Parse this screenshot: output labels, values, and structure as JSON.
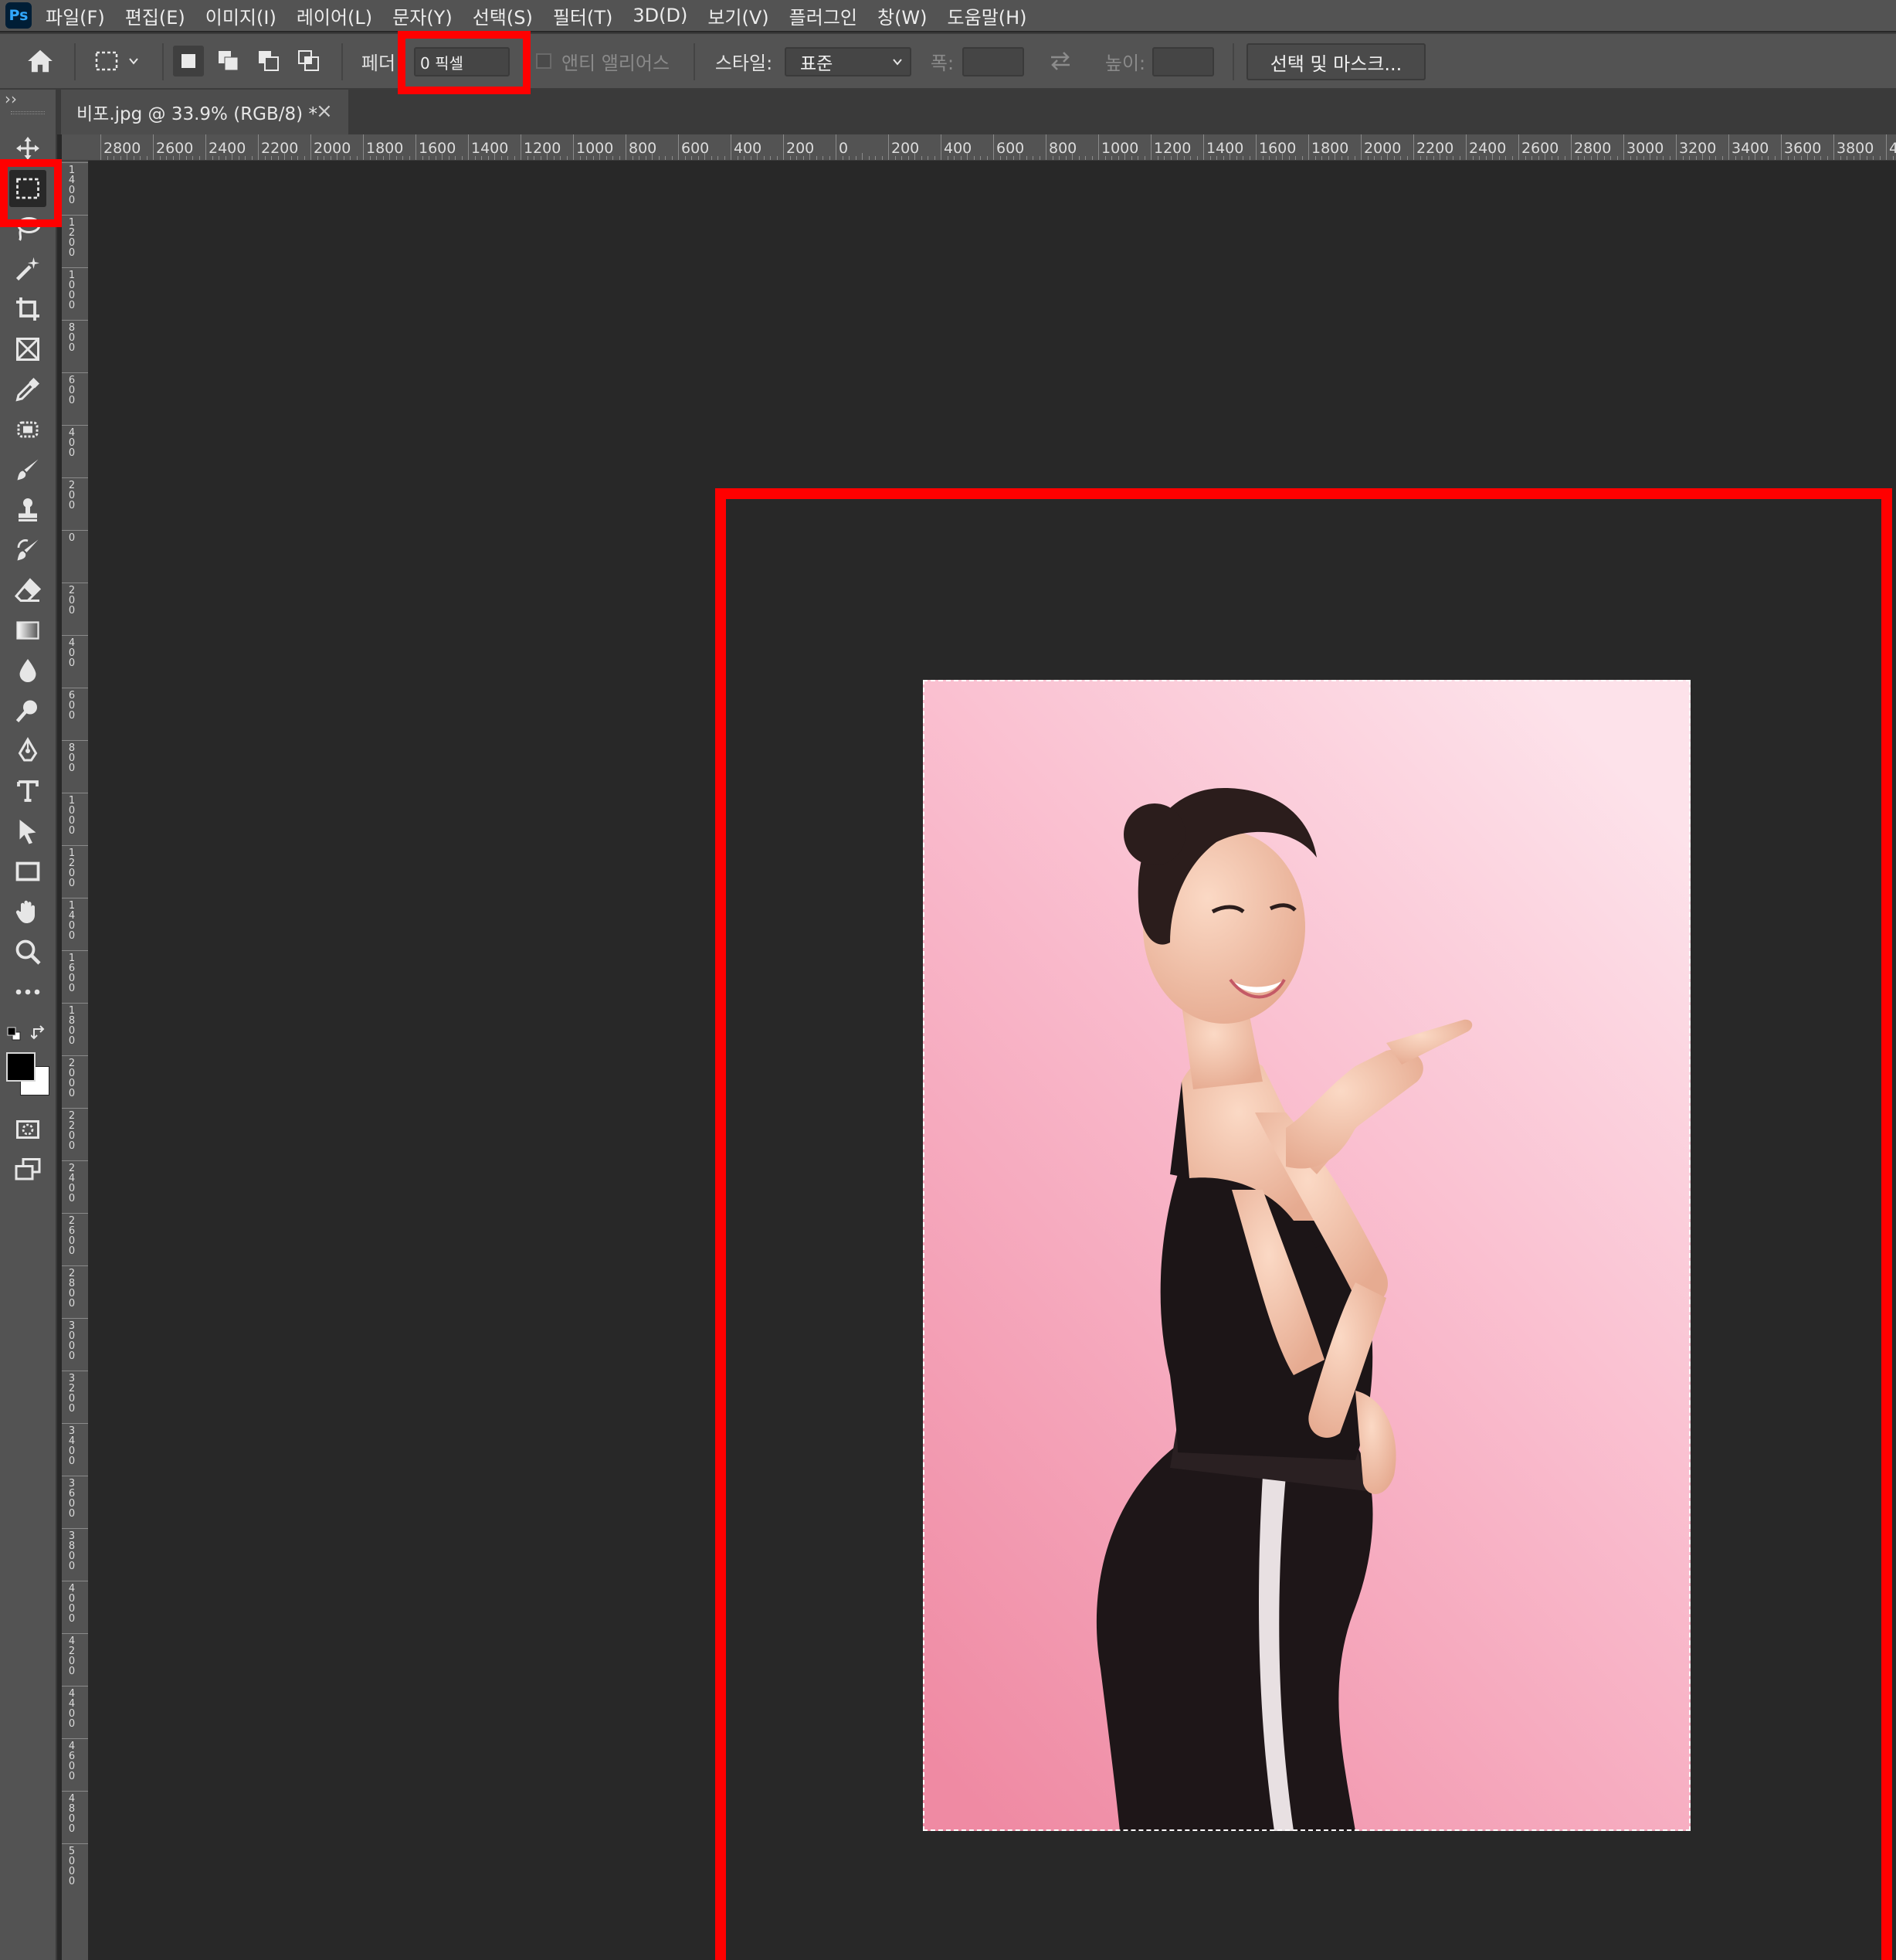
{
  "app": {
    "logo": "Ps"
  },
  "menu": {
    "items": [
      "파일(F)",
      "편집(E)",
      "이미지(I)",
      "레이어(L)",
      "문자(Y)",
      "선택(S)",
      "필터(T)",
      "3D(D)",
      "보기(V)",
      "플러그인",
      "창(W)",
      "도움말(H)"
    ]
  },
  "options": {
    "feather_label": "페더",
    "feather_value": "0 픽셀",
    "antialias_label": "앤티 앨리어스",
    "style_label": "스타일:",
    "style_value": "표준",
    "width_label": "폭:",
    "height_label": "높이:",
    "select_mask_button": "선택 및 마스크..."
  },
  "document": {
    "tab_title": "비포.jpg @ 33.9% (RGB/8) *",
    "close_glyph": "×"
  },
  "rulers": {
    "top_labels": [
      "2800",
      "2600",
      "2400",
      "2200",
      "2000",
      "1800",
      "1600",
      "1400",
      "1200",
      "1000",
      "800",
      "600",
      "400",
      "200",
      "0",
      "200",
      "400",
      "600",
      "800",
      "1000",
      "1200",
      "1400",
      "1600",
      "1800",
      "2000",
      "2200",
      "2400",
      "2600",
      "2800",
      "3000",
      "3200",
      "3400",
      "3600",
      "3800",
      "4"
    ],
    "left_labels": [
      "1400",
      "1200",
      "1000",
      "800",
      "600",
      "400",
      "200",
      "0",
      "200",
      "400",
      "600",
      "800",
      "1000",
      "1200",
      "1400",
      "1600",
      "1800",
      "2000",
      "2200",
      "2400",
      "2600",
      "2800",
      "3000",
      "3200",
      "3400",
      "3600",
      "3800",
      "4000",
      "4200",
      "4400",
      "4600",
      "4800",
      "5000"
    ]
  },
  "tools": [
    {
      "icon": "move-icon"
    },
    {
      "icon": "rectangular-marquee-icon",
      "active": true
    },
    {
      "icon": "lasso-icon"
    },
    {
      "icon": "magic-wand-icon"
    },
    {
      "icon": "crop-icon"
    },
    {
      "icon": "frame-icon"
    },
    {
      "icon": "eyedropper-icon"
    },
    {
      "icon": "spot-healing-icon"
    },
    {
      "icon": "brush-icon"
    },
    {
      "icon": "clone-stamp-icon"
    },
    {
      "icon": "history-brush-icon"
    },
    {
      "icon": "eraser-icon"
    },
    {
      "icon": "gradient-icon"
    },
    {
      "icon": "blur-icon"
    },
    {
      "icon": "dodge-icon"
    },
    {
      "icon": "pen-icon"
    },
    {
      "icon": "type-icon"
    },
    {
      "icon": "path-selection-icon"
    },
    {
      "icon": "rectangle-shape-icon"
    },
    {
      "icon": "hand-icon"
    },
    {
      "icon": "zoom-icon"
    },
    {
      "icon": "more-tools-icon"
    }
  ],
  "colors": {
    "highlight": "#ff0000",
    "foreground": "#000000",
    "background": "#ffffff",
    "photo_bg_top": "#fcd3df",
    "photo_bg_bottom": "#f28fa6"
  }
}
